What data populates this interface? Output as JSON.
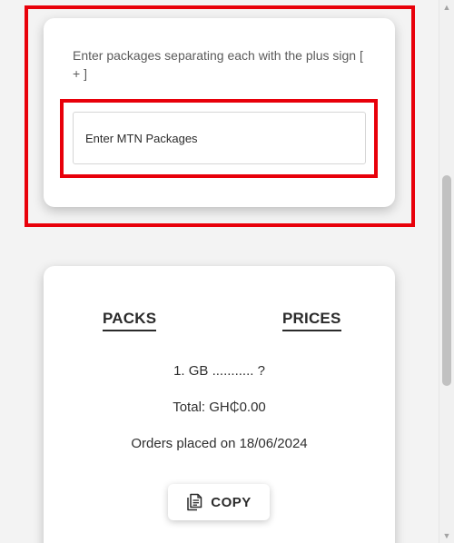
{
  "input_card": {
    "instruction": "Enter packages separating each with the plus sign [ + ]",
    "packages_placeholder": "Enter MTN Packages",
    "packages_value": ""
  },
  "summary_card": {
    "packs_header": "PACKS",
    "prices_header": "PRICES",
    "line_item": "1. GB ........... ?",
    "total": "Total: GH₵0.00",
    "orders_placed": "Orders placed on 18/06/2024",
    "copy_button": {
      "icon": "copy-document-icon",
      "label": "COPY"
    }
  },
  "highlight": {
    "color": "#e8000a"
  },
  "scrollbar": {
    "up_arrow": "▲",
    "down_arrow": "▼"
  }
}
